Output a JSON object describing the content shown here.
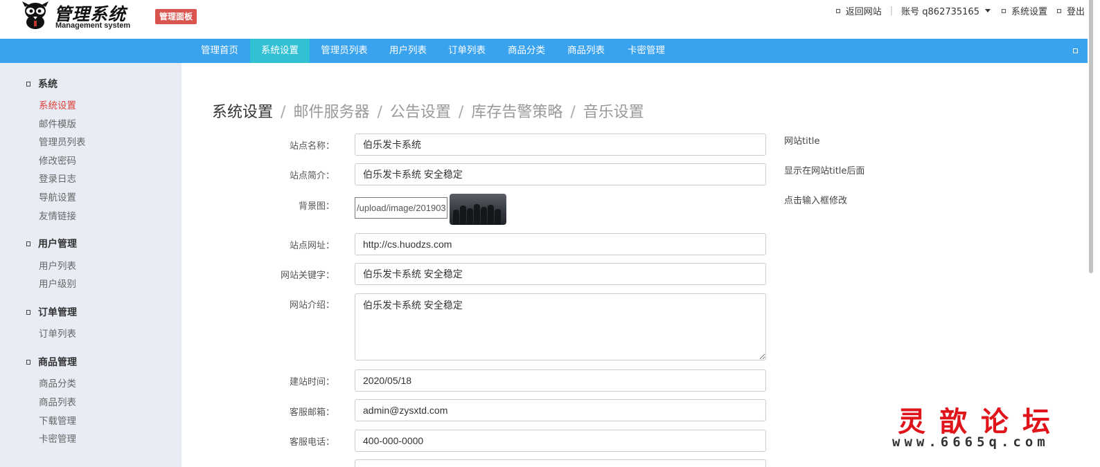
{
  "header": {
    "logo_title": "管理系统",
    "logo_subtitle": "Management system",
    "badge": "管理面板",
    "links": {
      "back_site": "返回网站",
      "account": "账号 q862735165",
      "settings": "系统设置",
      "logout": "登出"
    }
  },
  "nav": {
    "items": [
      {
        "label": "管理首页"
      },
      {
        "label": "系统设置",
        "active": true
      },
      {
        "label": "管理员列表"
      },
      {
        "label": "用户列表"
      },
      {
        "label": "订单列表"
      },
      {
        "label": "商品分类"
      },
      {
        "label": "商品列表"
      },
      {
        "label": "卡密管理"
      }
    ],
    "colors": {
      "bar": "#3aa3ef",
      "active": "#31c0d4"
    }
  },
  "sidebar": {
    "groups": [
      {
        "title": "系统",
        "items": [
          "系统设置",
          "邮件模版",
          "管理员列表",
          "修改密码",
          "登录日志",
          "导航设置",
          "友情链接"
        ]
      },
      {
        "title": "用户管理",
        "items": [
          "用户列表",
          "用户级别"
        ]
      },
      {
        "title": "订单管理",
        "items": [
          "订单列表"
        ]
      },
      {
        "title": "商品管理",
        "items": [
          "商品分类",
          "商品列表",
          "下载管理",
          "卡密管理"
        ]
      }
    ],
    "active_item": "系统设置",
    "active_color": "#e0413a"
  },
  "breadcrumbs": [
    "系统设置",
    "邮件服务器",
    "公告设置",
    "库存告警策略",
    "音乐设置"
  ],
  "form": {
    "site_name": {
      "label": "站点名称：",
      "value": "伯乐发卡系统"
    },
    "site_intro": {
      "label": "站点简介：",
      "value": "伯乐发卡系统 安全稳定"
    },
    "background": {
      "label": "背景图：",
      "value": "/upload/image/201903"
    },
    "site_url": {
      "label": "站点网址：",
      "value": "http://cs.huodzs.com"
    },
    "keywords": {
      "label": "网站关键字：",
      "value": "伯乐发卡系统 安全稳定"
    },
    "description": {
      "label": "网站介绍：",
      "value": "伯乐发卡系统 安全稳定"
    },
    "founded": {
      "label": "建站时间：",
      "value": "2020/05/18"
    },
    "email": {
      "label": "客服邮箱：",
      "value": "admin@zysxtd.com"
    },
    "phone": {
      "label": "客服电话：",
      "value": "400-000-0000"
    }
  },
  "hints": {
    "title": "网站title",
    "subtitle": "显示在网站title后面",
    "click": "点击输入框修改"
  },
  "watermark": {
    "title": "灵歆论坛",
    "url": "www.6665q.com"
  }
}
